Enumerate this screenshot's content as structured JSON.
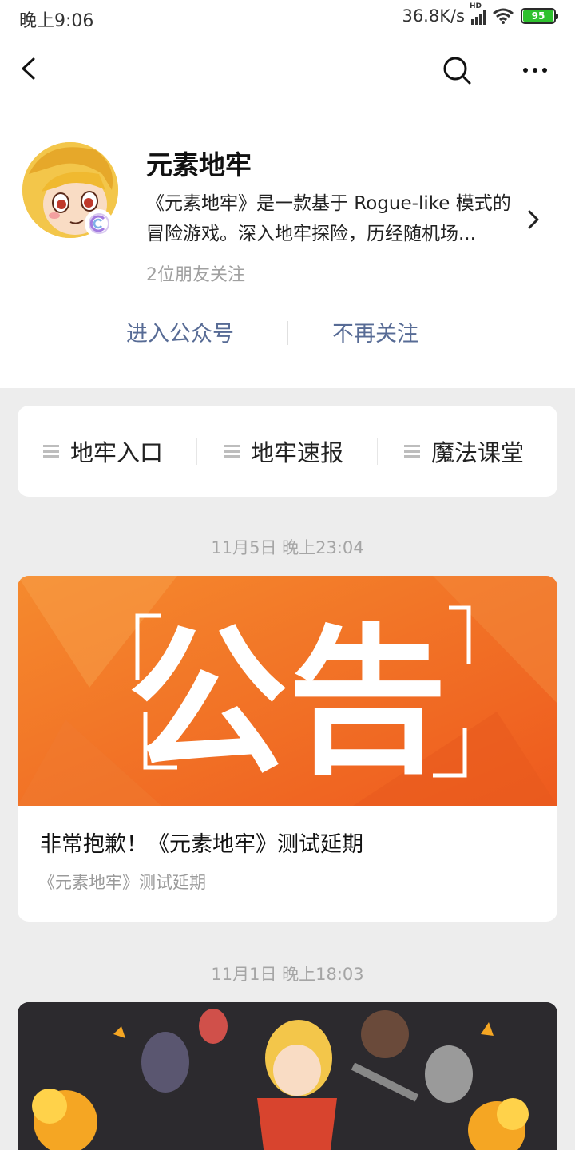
{
  "status_bar": {
    "time": "晚上9:06",
    "network_speed": "36.8K/s",
    "signal_label": "HD",
    "battery": "95",
    "battery_color": "#2ec12e"
  },
  "nav": {
    "back_icon": "chevron-left-icon",
    "search_icon": "search-icon",
    "more_icon": "more-icon"
  },
  "profile": {
    "name": "元素地牢",
    "description": "《元素地牢》是一款基于 Rogue-like 模式的冒险游戏。深入地牢探险，历经随机场...",
    "followers": "2位朋友关注",
    "enter_label": "进入公众号",
    "unfollow_label": "不再关注",
    "link_color": "#576b95"
  },
  "menu": {
    "items": [
      {
        "label": "地牢入口",
        "icon": "menu-icon"
      },
      {
        "label": "地牢速报",
        "icon": "menu-icon"
      },
      {
        "label": "魔法课堂",
        "icon": "menu-icon"
      }
    ]
  },
  "articles": [
    {
      "timestamp": "11月5日 晚上23:04",
      "cover_text": "公告",
      "title": "非常抱歉！《元素地牢》测试延期",
      "digest": "《元素地牢》测试延期",
      "cover_color": "#f26a22"
    },
    {
      "timestamp": "11月1日 晚上18:03",
      "cover_color": "#2c2a2e"
    }
  ]
}
